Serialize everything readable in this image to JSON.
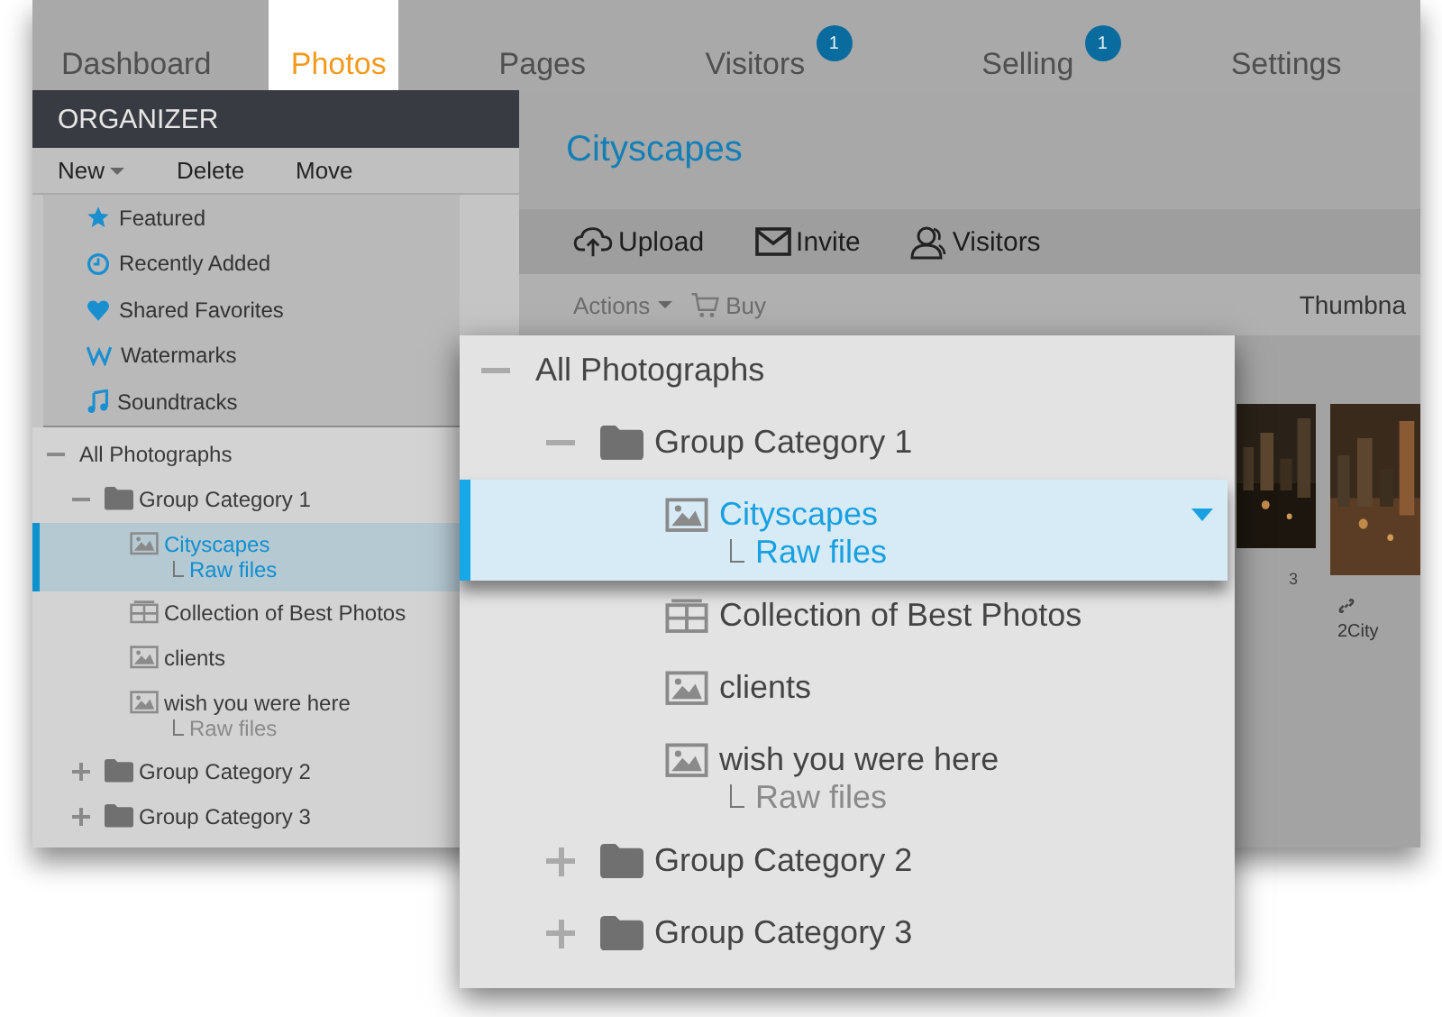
{
  "tabs": [
    {
      "label": "Dashboard",
      "selected": false
    },
    {
      "label": "Photos",
      "selected": true
    },
    {
      "label": "Pages",
      "selected": false
    },
    {
      "label": "Visitors",
      "selected": false,
      "badge": "1"
    },
    {
      "label": "Selling",
      "selected": false,
      "badge": "1"
    },
    {
      "label": "Settings",
      "selected": false
    }
  ],
  "organizer": {
    "title": "ORGANIZER",
    "menu": [
      {
        "label": "New",
        "kind": "dropdown"
      },
      {
        "label": "Delete",
        "kind": "plain"
      },
      {
        "label": "Move",
        "kind": "plain"
      }
    ],
    "library": [
      {
        "label": "Featured",
        "kind": "star"
      },
      {
        "label": "Recently Added",
        "kind": "clock"
      },
      {
        "label": "Shared Favorites",
        "kind": "heart"
      },
      {
        "label": "Watermarks",
        "kind": "watermark"
      },
      {
        "label": "Soundtracks",
        "kind": "music"
      }
    ],
    "tree": {
      "label": "All Photographs",
      "expanded": true,
      "selected": false,
      "children": [
        {
          "label": "Group Category 1",
          "kind": "group",
          "expanded": true,
          "selected": false,
          "children": [
            {
              "label": "Cityscapes",
              "kind": "gallery",
              "selected": true,
              "sub": "Raw files"
            },
            {
              "label": "Collection of Best Photos",
              "kind": "collection",
              "selected": false
            },
            {
              "label": "clients",
              "kind": "gallery",
              "selected": false
            },
            {
              "label": "wish you were here",
              "kind": "gallery",
              "selected": false,
              "sub": "Raw files"
            }
          ]
        },
        {
          "label": "Group Category 2",
          "kind": "group",
          "expanded": false,
          "selected": false
        },
        {
          "label": "Group Category 3",
          "kind": "group",
          "expanded": false,
          "selected": false
        }
      ]
    }
  },
  "main": {
    "title": "Cityscapes",
    "toolbar": [
      {
        "label": "Upload",
        "kind": "upload"
      },
      {
        "label": "Invite",
        "kind": "mail"
      },
      {
        "label": "Visitors",
        "kind": "people"
      }
    ],
    "actions": [
      {
        "label": "Actions",
        "kind": "dropdown"
      },
      {
        "label": "Buy",
        "kind": "cart"
      }
    ],
    "view_label": "Thumbna",
    "thumbs": [
      {
        "caption": "3",
        "kind": "count"
      },
      {
        "caption": "2City",
        "kind": "link"
      }
    ]
  },
  "callout": {
    "tree": {
      "label": "All Photographs",
      "expanded": true,
      "selected": false,
      "children": [
        {
          "label": "Group Category 1",
          "kind": "group",
          "expanded": true,
          "selected": false,
          "children": [
            {
              "label": "Cityscapes",
              "kind": "gallery",
              "selected": true,
              "sub": "Raw files"
            },
            {
              "label": "Collection of Best Photos",
              "kind": "collection",
              "selected": false
            },
            {
              "label": "clients",
              "kind": "gallery",
              "selected": false
            },
            {
              "label": "wish you were here",
              "kind": "gallery",
              "selected": false,
              "sub": "Raw files"
            }
          ]
        },
        {
          "label": "Group Category 2",
          "kind": "group",
          "expanded": false,
          "selected": false
        },
        {
          "label": "Group Category 3",
          "kind": "group",
          "expanded": false,
          "selected": false
        }
      ]
    }
  }
}
